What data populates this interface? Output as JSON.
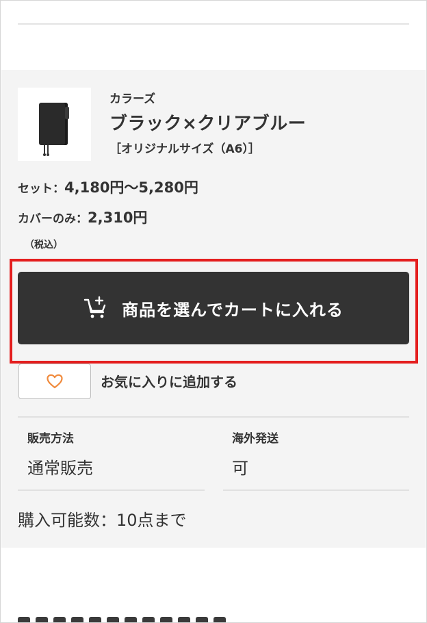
{
  "product": {
    "series_label": "カラーズ",
    "name": "ブラック×クリアブルー",
    "size": "［オリジナルサイズ（A6）］",
    "thumbnail_icon": "notebook-cover-image"
  },
  "pricing": {
    "set_label": "セット：",
    "set_value": "4,180円〜5,280円",
    "cover_label": "カバーのみ：",
    "cover_value": "2,310円",
    "tax_note": "（税込）"
  },
  "actions": {
    "cart_button_label": "商品を選んでカートに入れる",
    "cart_icon": "cart-plus-icon",
    "favorite_label": "お気に入りに追加する",
    "favorite_icon": "heart-icon",
    "highlight_color": "#e41e1e",
    "favorite_icon_color": "#f08a3c"
  },
  "info": {
    "sales_method_label": "販売方法",
    "sales_method_value": "通常販売",
    "overseas_label": "海外発送",
    "overseas_value": "可",
    "purchase_limit": "購入可能数：10点まで"
  },
  "colors": {
    "panel_bg": "#f4f4f4",
    "button_bg": "#333333",
    "text": "#333333"
  }
}
